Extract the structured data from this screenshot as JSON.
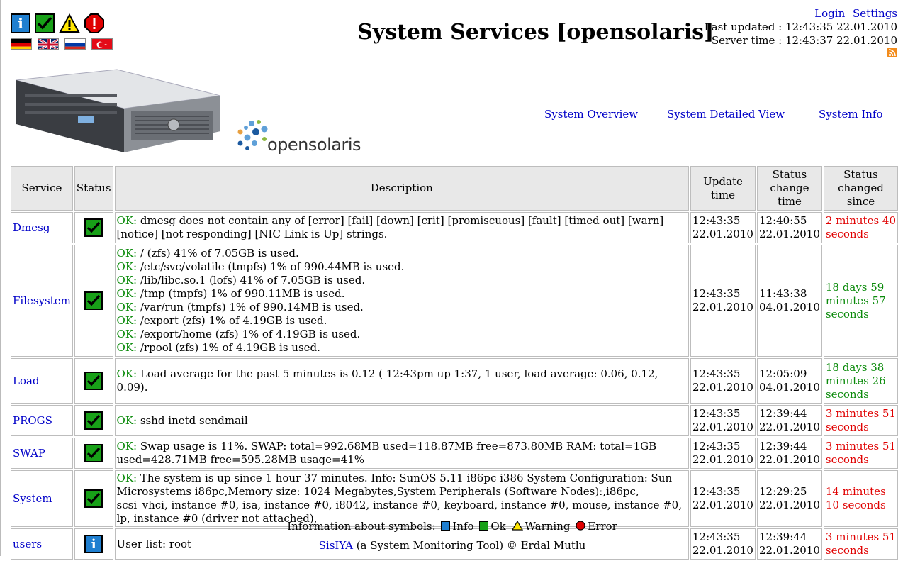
{
  "header": {
    "title": "System Services [opensolaris]",
    "login": "Login",
    "settings": "Settings",
    "last_updated": "Last updated : 12:43:35 22.01.2010",
    "server_time": "Server time : 12:43:37 22.01.2010"
  },
  "top_icons": [
    "info-icon",
    "ok-icon",
    "warning-icon",
    "error-icon"
  ],
  "flags": [
    "german-flag",
    "uk-flag",
    "russian-flag",
    "turkish-flag"
  ],
  "logo_text": "opensolaris",
  "nav": {
    "overview": "System Overview",
    "detailed": "System Detailed View",
    "info": "System Info"
  },
  "table": {
    "headers": {
      "service": "Service",
      "status": "Status",
      "description": "Description",
      "update_time": "Update time",
      "status_change_time": "Status change time",
      "status_changed_since": "Status changed since"
    },
    "rows": [
      {
        "service": "Dmesg",
        "status": "ok",
        "description": [
          {
            "prefix": "OK:",
            "text": " dmesg does not contain any of [error] [fail] [down] [crit] [promiscuous] [fault] [timed out] [warn] [notice] [not responding] [NIC Link is Up] strings."
          }
        ],
        "update_time": "12:43:35 22.01.2010",
        "change_time": "12:40:55 22.01.2010",
        "since": "2 minutes 40 seconds",
        "since_color": "red"
      },
      {
        "service": "Filesystem",
        "status": "ok",
        "description": [
          {
            "prefix": "OK:",
            "text": " / (zfs) 41% of 7.05GB is used."
          },
          {
            "prefix": "OK:",
            "text": " /etc/svc/volatile (tmpfs) 1% of 990.44MB is used."
          },
          {
            "prefix": "OK:",
            "text": " /lib/libc.so.1 (lofs) 41% of 7.05GB is used."
          },
          {
            "prefix": "OK:",
            "text": " /tmp (tmpfs) 1% of 990.11MB is used."
          },
          {
            "prefix": "OK:",
            "text": " /var/run (tmpfs) 1% of 990.14MB is used."
          },
          {
            "prefix": "OK:",
            "text": " /export (zfs) 1% of 4.19GB is used."
          },
          {
            "prefix": "OK:",
            "text": " /export/home (zfs) 1% of 4.19GB is used."
          },
          {
            "prefix": "OK:",
            "text": " /rpool (zfs) 1% of 4.19GB is used."
          }
        ],
        "update_time": "12:43:35 22.01.2010",
        "change_time": "11:43:38 04.01.2010",
        "since": "18 days 59 minutes 57 seconds",
        "since_color": "green"
      },
      {
        "service": "Load",
        "status": "ok",
        "description": [
          {
            "prefix": "OK:",
            "text": " Load average for the past 5 minutes is 0.12 ( 12:43pm up 1:37, 1 user, load average: 0.06, 0.12, 0.09)."
          }
        ],
        "update_time": "12:43:35 22.01.2010",
        "change_time": "12:05:09 04.01.2010",
        "since": "18 days 38 minutes 26 seconds",
        "since_color": "green"
      },
      {
        "service": "PROGS",
        "status": "ok",
        "description": [
          {
            "prefix": "OK:",
            "text": " sshd inetd sendmail"
          }
        ],
        "update_time": "12:43:35 22.01.2010",
        "change_time": "12:39:44 22.01.2010",
        "since": "3 minutes 51 seconds",
        "since_color": "red"
      },
      {
        "service": "SWAP",
        "status": "ok",
        "description": [
          {
            "prefix": "OK:",
            "text": " Swap usage is 11%. SWAP: total=992.68MB used=118.87MB free=873.80MB RAM: total=1GB used=428.71MB free=595.28MB usage=41%"
          }
        ],
        "update_time": "12:43:35 22.01.2010",
        "change_time": "12:39:44 22.01.2010",
        "since": "3 minutes 51 seconds",
        "since_color": "red"
      },
      {
        "service": "System",
        "status": "ok",
        "description": [
          {
            "prefix": "OK:",
            "text": " The system is up since 1 hour 37 minutes. Info: SunOS 5.11 i86pc i386 System Configuration: Sun Microsystems i86pc,Memory size: 1024 Megabytes,System Peripherals (Software Nodes):,i86pc, scsi_vhci, instance #0, isa, instance #0, i8042, instance #0, keyboard, instance #0, mouse, instance #0, lp, instance #0 (driver not attached),"
          }
        ],
        "update_time": "12:43:35 22.01.2010",
        "change_time": "12:29:25 22.01.2010",
        "since": "14 minutes 10 seconds",
        "since_color": "red"
      },
      {
        "service": "users",
        "status": "info",
        "description": [
          {
            "prefix": "",
            "text": "User list: root"
          }
        ],
        "update_time": "12:43:35 22.01.2010",
        "change_time": "12:39:44 22.01.2010",
        "since": "3 minutes 51 seconds",
        "since_color": "red"
      }
    ]
  },
  "legend": {
    "intro": "Information about symbols:",
    "info": "Info",
    "ok": "Ok",
    "warning": "Warning",
    "error": "Error"
  },
  "footer": {
    "link": "SisIYA",
    "text": " (a System Monitoring Tool) © Erdal Mutlu"
  },
  "colors": {
    "link": "#0000c8",
    "ok_green": "#0a8a0a",
    "red": "#e00000",
    "header_bg": "#e8e8e8"
  }
}
